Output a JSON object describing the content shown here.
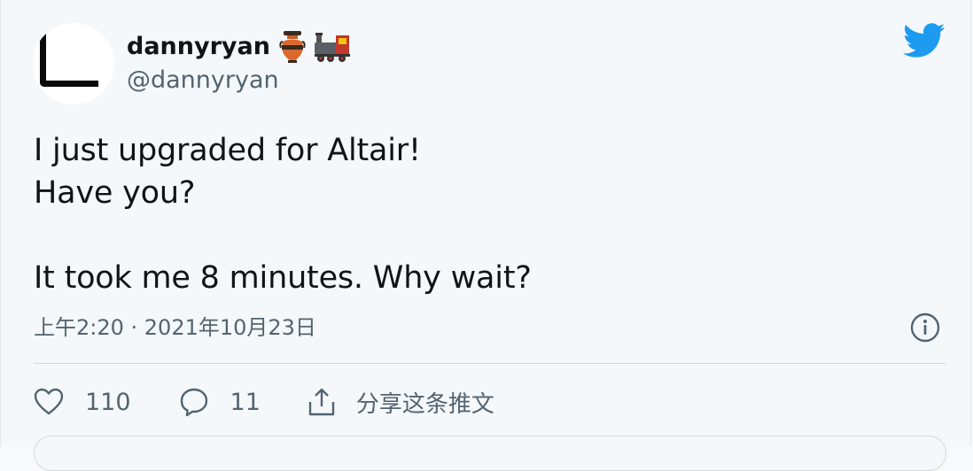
{
  "author": {
    "display_name": "dannyryan",
    "emojis": [
      "amphora-emoji",
      "locomotive-emoji"
    ],
    "handle": "@dannyryan"
  },
  "tweet": {
    "text": "I just upgraded for Altair!\nHave you?\n\nIt took me 8 minutes. Why wait?",
    "timestamp": "上午2:20 · 2021年10月23日"
  },
  "actions": {
    "likes": "110",
    "replies": "11",
    "share_label": "分享这条推文"
  },
  "icons": {
    "brand": "twitter-bird-icon",
    "info": "info-icon",
    "like": "heart-icon",
    "reply": "reply-icon",
    "share": "share-icon"
  },
  "colors": {
    "twitter_blue": "#1d9bf0",
    "secondary_text": "#536471",
    "primary_text": "#0f1419",
    "background": "#f5f8fa"
  }
}
